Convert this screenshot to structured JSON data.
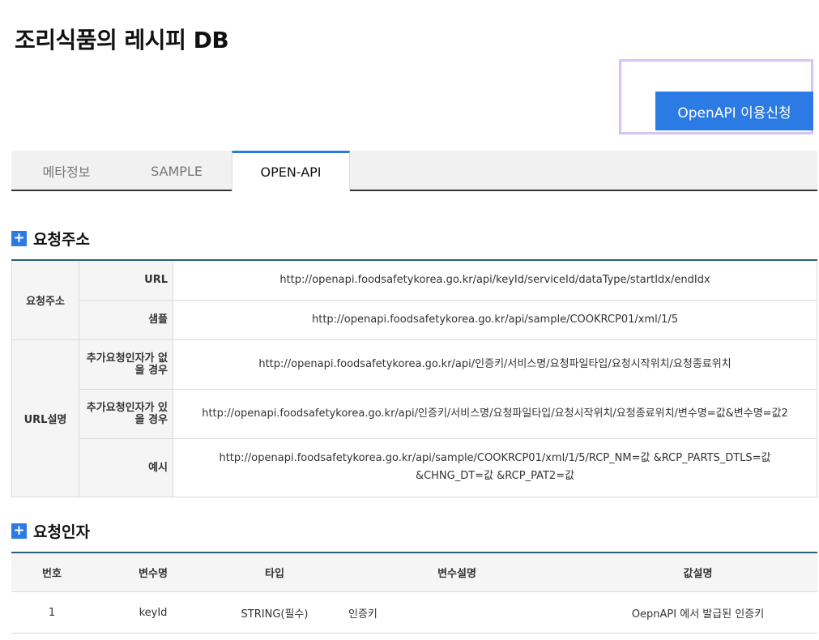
{
  "page": {
    "title": "조리식품의 레시피 DB"
  },
  "apply_button": {
    "label": "OpenAPI 이용신청"
  },
  "tabs": [
    {
      "label": "메타정보",
      "active": false
    },
    {
      "label": "SAMPLE",
      "active": false
    },
    {
      "label": "OPEN-API",
      "active": true
    }
  ],
  "sections": {
    "request_address": "요청주소",
    "request_params": "요청인자"
  },
  "request_table": {
    "group1": "요청주소",
    "group2": "URL설명",
    "rows": [
      {
        "label": "URL",
        "value": "http://openapi.foodsafetykorea.go.kr/api/keyId/serviceId/dataType/startIdx/endIdx"
      },
      {
        "label": "샘플",
        "value": "http://openapi.foodsafetykorea.go.kr/api/sample/COOKRCP01/xml/1/5"
      },
      {
        "label": "추가요청인자가 없을 경우",
        "value": "http://openapi.foodsafetykorea.go.kr/api/인증키/서비스명/요청파일타입/요청시작위치/요청종료위치"
      },
      {
        "label": "추가요청인자가 있을 경우",
        "value": "http://openapi.foodsafetykorea.go.kr/api/인증키/서비스명/요청파일타입/요청시작위치/요청종료위치/변수명=값&변수명=값2"
      },
      {
        "label": "예시",
        "value": "http://openapi.foodsafetykorea.go.kr/api/sample/COOKRCP01/xml/1/5/RCP_NM=값 &RCP_PARTS_DTLS=값 &CHNG_DT=값 &RCP_PAT2=값"
      }
    ]
  },
  "params_table": {
    "headers": [
      "번호",
      "변수명",
      "타입",
      "변수설명",
      "값설명"
    ],
    "rows": [
      {
        "no": "1",
        "name": "keyId",
        "type": "STRING(필수)",
        "desc": "인증키",
        "value_desc": "OepnAPI 에서 발급된 인증키"
      }
    ]
  },
  "colors": {
    "accent": "#2c7be5",
    "highlight": "#d5c4f2",
    "table_border": "#2e5e7a"
  }
}
